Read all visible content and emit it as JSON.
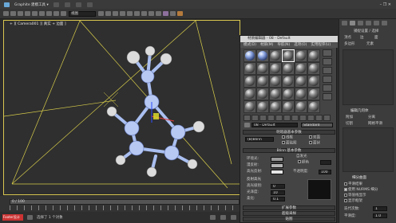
{
  "app": {
    "title": "Graphite 建模工具 ▾",
    "window_buttons": "– ❐ ✕"
  },
  "toolbar": {
    "selection_filter": "视图"
  },
  "viewport": {
    "label": "+ ][ Camera001 ][ 真实 + 边面 ]"
  },
  "material_editor": {
    "title": "材质编辑器 - 08 - Default",
    "menu": [
      "模式(D)",
      "材质(M)",
      "导航(N)",
      "选项(O)",
      "实用程序(U)"
    ],
    "material_name": "08 - Default",
    "material_type": "Standard",
    "shader_rollout": "明暗器基本参数",
    "shader_type": "(B)Blinn",
    "shader_options": [
      "线框",
      "双面",
      "面贴图",
      "面状"
    ],
    "blinn_rollout": "Blinn 基本参数",
    "self_illum_label": "自发光",
    "color_label": "颜色",
    "ambient_label": "环境光:",
    "diffuse_label": "漫反射:",
    "specular_label": "高光反射:",
    "opacity_label": "不透明度:",
    "opacity_value": "100",
    "specular_highlights": "反射高光",
    "spec_level_label": "高光级别:",
    "spec_level_value": "0",
    "gloss_label": "光泽度:",
    "gloss_value": "10",
    "soften_label": "柔化:",
    "soften_value": "0.1",
    "rollouts": [
      "扩展参数",
      "超级采样",
      "贴图"
    ],
    "colors": {
      "ambient": "#9a9a9a",
      "diffuse": "#b4b4b4",
      "specular": "#e6e6e6"
    }
  },
  "command_panel": {
    "section1": "捕捉设置 / 选择",
    "items": [
      "顶点",
      "边",
      "面",
      "多边形",
      "元素"
    ],
    "section2": "编辑几何体",
    "options": [
      "附加",
      "分离",
      "切割",
      "网格平滑"
    ],
    "section3": "细分曲面",
    "checks": [
      "平滑结果",
      "使用 NURMS 细分",
      "等值线显示",
      "显示框架"
    ],
    "iter_label": "迭代次数:",
    "iter_value": "1",
    "smooth_label": "平滑度:",
    "smooth_value": "1.0"
  },
  "timeline": {
    "frame_readout": "0 / 100",
    "status_text": "选择了 1 个对象",
    "brand": "Footer设计"
  }
}
